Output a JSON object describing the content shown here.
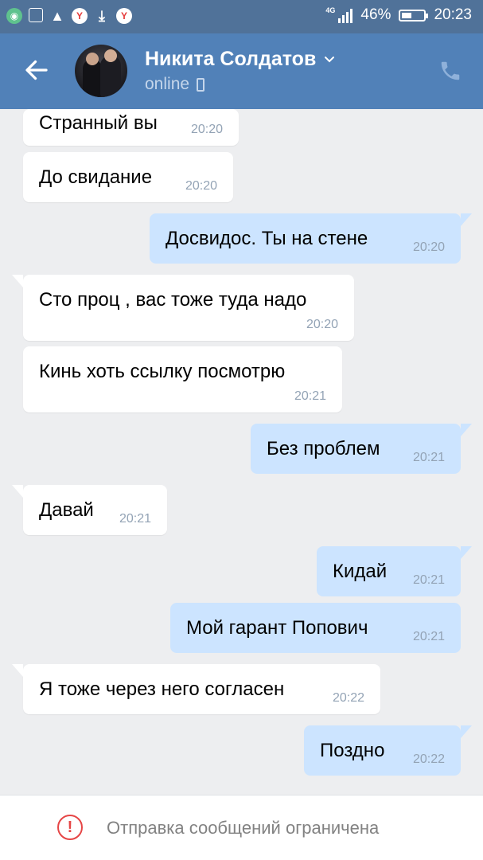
{
  "status_bar": {
    "network": "4G",
    "battery": "46%",
    "battery_level": 0.46,
    "time": "20:23",
    "icons": [
      "tracker-icon",
      "screenshot-icon",
      "warning-icon",
      "yandex-icon",
      "download-icon",
      "yandex-icon"
    ]
  },
  "header": {
    "contact_name": "Никита Солдатов",
    "presence": "online",
    "icons": [
      "back-arrow-icon",
      "chevron-down-icon",
      "mobile-phone-icon",
      "phone-call-icon"
    ]
  },
  "messages": [
    {
      "dir": "in",
      "text": "Странный вы",
      "time": "20:20"
    },
    {
      "dir": "in",
      "text": "До свидание",
      "time": "20:20"
    },
    {
      "dir": "out",
      "text": "Досвидос. Ты на стене",
      "time": "20:20"
    },
    {
      "dir": "in",
      "text": "Сто проц , вас тоже туда надо",
      "time": "20:20"
    },
    {
      "dir": "in",
      "text": "Кинь хоть ссылку посмотрю",
      "time": "20:21"
    },
    {
      "dir": "out",
      "text": "Без проблем",
      "time": "20:21"
    },
    {
      "dir": "in",
      "text": "Давай",
      "time": "20:21"
    },
    {
      "dir": "out",
      "text": "Кидай",
      "time": "20:21"
    },
    {
      "dir": "out",
      "text": "Мой гарант Попович",
      "time": "20:21"
    },
    {
      "dir": "in",
      "text": "Я тоже через него согласен",
      "time": "20:22"
    },
    {
      "dir": "out",
      "text": "Поздно",
      "time": "20:22"
    }
  ],
  "footer": {
    "notice": "Отправка сообщений ограничена",
    "icon": "exclamation-circle-icon"
  },
  "colors": {
    "status_bar_bg": "#507299",
    "header_bg": "#5181b8",
    "chat_bg": "#edeef0",
    "incoming_bubble": "#ffffff",
    "outgoing_bubble": "#cce4ff",
    "time_text": "#93a3b5",
    "warning_red": "#e64646"
  }
}
